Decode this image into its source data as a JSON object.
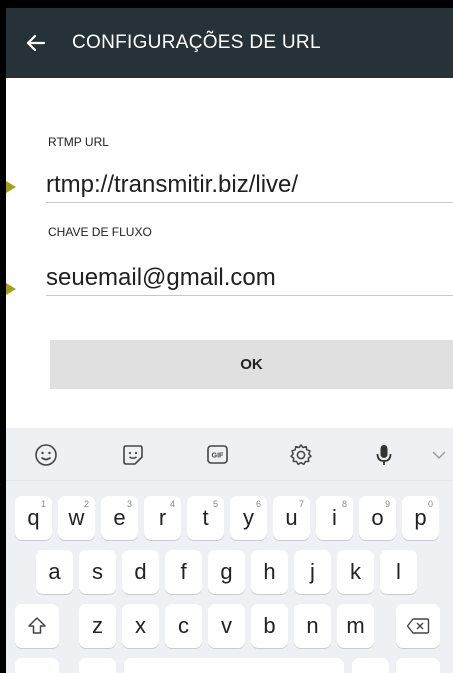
{
  "appbar": {
    "title": "CONFIGURAÇÕES DE URL",
    "back_icon": "arrow-left-icon"
  },
  "form": {
    "rtmp_label": "RTMP URL",
    "rtmp_value": "rtmp://transmitir.biz/live/",
    "key_label": "CHAVE DE FLUXO",
    "key_value": "seuemail@gmail.com",
    "ok_label": "OK"
  },
  "keyboard": {
    "toolbar": [
      "emoji-icon",
      "sticker-icon",
      "gif-icon",
      "settings-icon",
      "microphone-icon",
      "chevron-down-icon"
    ],
    "gif_text": "GIF",
    "row1": [
      "q",
      "w",
      "e",
      "r",
      "t",
      "y",
      "u",
      "i",
      "o",
      "p"
    ],
    "row1_hints": [
      "1",
      "2",
      "3",
      "4",
      "5",
      "6",
      "7",
      "8",
      "9",
      "0"
    ],
    "row2": [
      "a",
      "s",
      "d",
      "f",
      "g",
      "h",
      "j",
      "k",
      "l"
    ],
    "row3": [
      "z",
      "x",
      "c",
      "v",
      "b",
      "n",
      "m"
    ]
  },
  "colors": {
    "appbar": "#263238",
    "accent_arrow": "#a0a01a",
    "ok_button": "#e0e0e0"
  }
}
